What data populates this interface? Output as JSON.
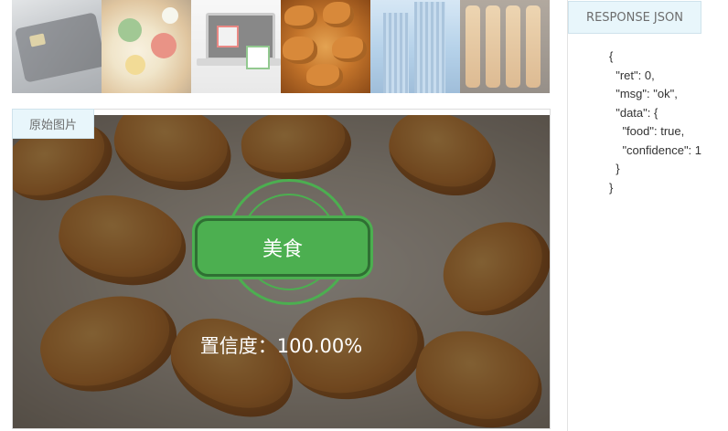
{
  "thumbnails": [
    {
      "name": "thumb-bank-card",
      "alt": "bank card"
    },
    {
      "name": "thumb-plated-food",
      "alt": "plated food"
    },
    {
      "name": "thumb-laptop-gift",
      "alt": "laptop gifts"
    },
    {
      "name": "thumb-chicken-wings",
      "alt": "chicken wings"
    },
    {
      "name": "thumb-skyscrapers",
      "alt": "skyscrapers"
    },
    {
      "name": "thumb-grilled-skewers",
      "alt": "grilled skewers"
    }
  ],
  "image_panel": {
    "tag_label": "原始图片",
    "result_label": "美食",
    "confidence_label": "置信度：",
    "confidence_value": "100.00%"
  },
  "response": {
    "tag_label": "RESPONSE JSON",
    "json_text": "{\n  \"ret\": 0,\n  \"msg\": \"ok\",\n  \"data\": {\n    \"food\": true,\n    \"confidence\": 1\n  }\n}"
  },
  "colors": {
    "badge_green": "#4caf50",
    "badge_border": "#2f6f33",
    "tab_background": "#e8f6fb"
  }
}
